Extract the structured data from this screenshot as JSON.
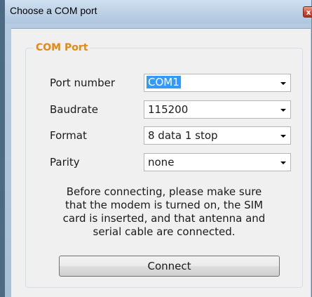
{
  "window": {
    "title": "Choose a COM port",
    "close_glyph": "x"
  },
  "group": {
    "title": "COM Port"
  },
  "fields": [
    {
      "label": "Port number",
      "value": "COM1",
      "selected": true
    },
    {
      "label": "Baudrate",
      "value": "115200",
      "selected": false
    },
    {
      "label": "Format",
      "value": "8 data 1 stop",
      "selected": false
    },
    {
      "label": "Parity",
      "value": "none",
      "selected": false
    }
  ],
  "notice": {
    "lines": [
      "Before connecting, please make sure",
      "that the modem is turned on, the SIM",
      "card is inserted, and that antenna and",
      "serial cable are connected."
    ]
  },
  "buttons": {
    "connect_label": "Connect"
  },
  "colors": {
    "group_title": "#e8880f",
    "selection": "#3399ff",
    "close_button": "#d3452c"
  },
  "icons": {
    "close": "close-icon",
    "dropdown": "chevron-down-icon"
  }
}
